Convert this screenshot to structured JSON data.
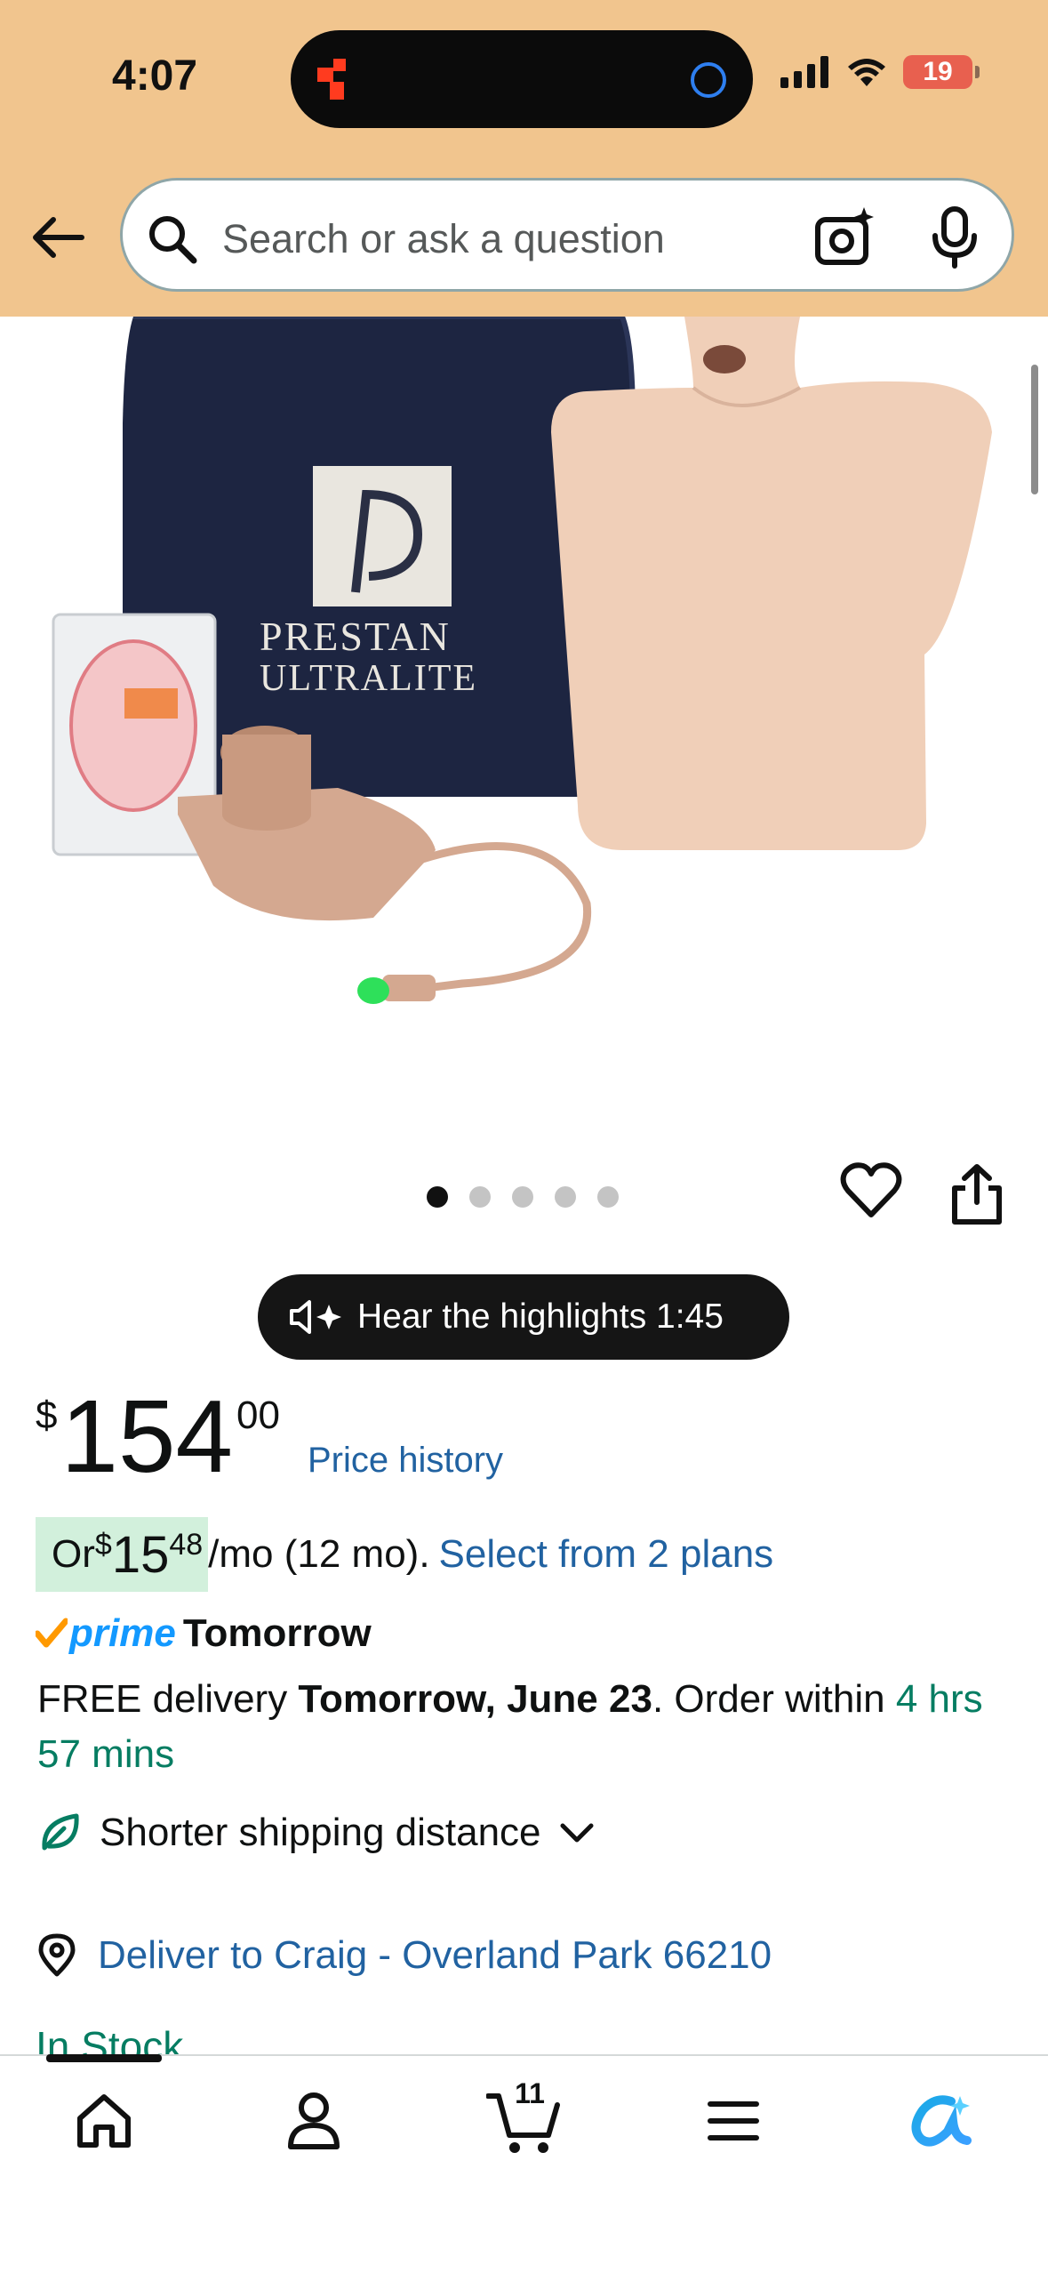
{
  "status_bar": {
    "time": "4:07",
    "battery": "19"
  },
  "search": {
    "placeholder": "Search or ask a question"
  },
  "product": {
    "bag_brand": "PRESTAN",
    "bag_model": "ULTRALITE",
    "image_count": 5,
    "active_image": 1
  },
  "audio": {
    "label": "Hear the highlights 1:45"
  },
  "price": {
    "symbol": "$",
    "whole": "154",
    "cents": "00",
    "history_link": "Price history"
  },
  "monthly": {
    "prefix": "Or ",
    "symbol": "$",
    "amount": "15",
    "cents": "48",
    "terms": "/mo (12 mo).",
    "plans_link": "Select from 2 plans"
  },
  "prime": {
    "word": "prime",
    "day": "Tomorrow"
  },
  "delivery": {
    "free_text": "FREE delivery ",
    "date": "Tomorrow, June 23",
    "order_within": ". Order within ",
    "countdown": "4 hrs 57 mins"
  },
  "shipping": {
    "label": "Shorter shipping distance"
  },
  "deliver_to": {
    "label": "Deliver to Craig - Overland Park 66210"
  },
  "stock": {
    "label": "In Stock"
  },
  "nav": {
    "cart_count": "11"
  },
  "colors": {
    "header_bg": "#f1c58e",
    "link": "#2162a1",
    "green": "#067d62",
    "prime_blue": "#1399ff",
    "bag_navy": "#1d2541",
    "manikin_skin": "#f0cfb8"
  }
}
